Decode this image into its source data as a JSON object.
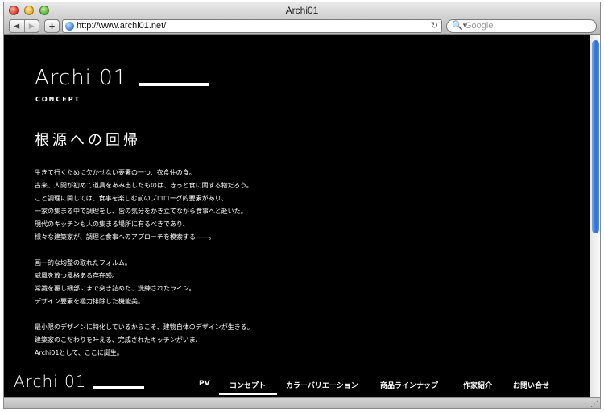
{
  "window": {
    "title": "Archi01"
  },
  "toolbar": {
    "back_glyph": "◀",
    "forward_glyph": "▶",
    "add_glyph": "+",
    "url": "http://www.archi01.net/",
    "reload_glyph": "↻",
    "search_glyph": "🔍▾",
    "search_placeholder": "Google"
  },
  "page": {
    "logo": "Archi 01",
    "logo_subtitle": "CONCEPT",
    "headline": "根源への回帰",
    "paragraphs": [
      [
        "生きて行くために欠かせない要素の一つ、衣食住の食。",
        "古来、人間が初めて道具をあみ出したものは、きっと食に関する物だろう。",
        "こと調理に関しては、食事を楽しむ前のプロローグ的要素があり、",
        "一家の集まる中で調理をし、皆の気分をかき立てながら食事へと赴いた。",
        "現代のキッチンも人の集まる場所に有るべきであり、",
        "様々な建築家が、調理と食事へのアプローチを模索する――。"
      ],
      [
        "画一的な均整の取れたフォルム。",
        "威風を放つ風格ある存在感。",
        "常識を覆し細部にまで突き詰めた、洗練されたライン。",
        "デザイン要素を極力排除した機能美。"
      ],
      [
        "最小限のデザインに特化しているからこそ、建物自体のデザインが生きる。",
        "建築家のこだわりを叶える、完成されたキッチンがいま、",
        "Archi01として、ここに誕生。"
      ]
    ],
    "footer_logo": "Archi 01",
    "nav": [
      {
        "label": "PV"
      },
      {
        "label": "コンセプト",
        "active": true
      },
      {
        "label": "カラーバリエーション"
      },
      {
        "label": "商品ラインナップ"
      },
      {
        "label": "作家紹介"
      },
      {
        "label": "お問い合せ"
      }
    ]
  }
}
